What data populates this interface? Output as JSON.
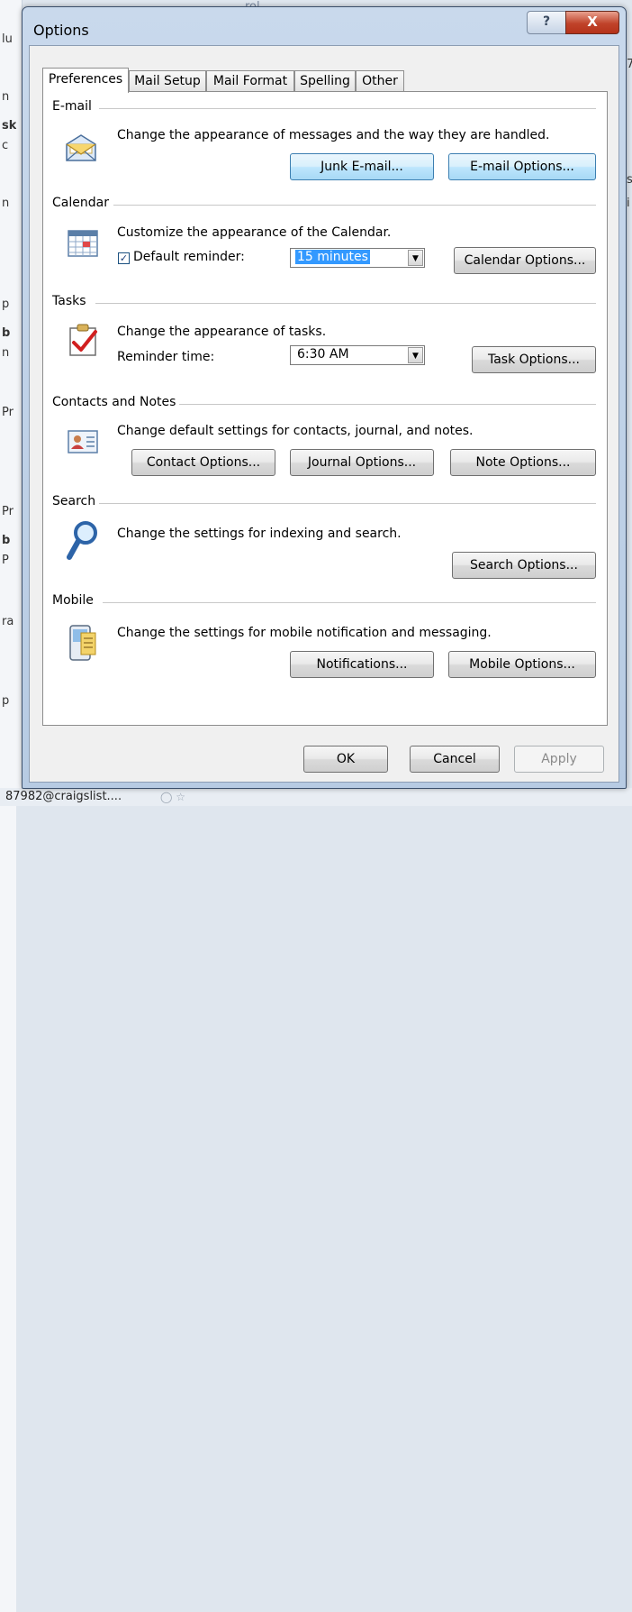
{
  "window": {
    "title": "Options",
    "help_label": "?",
    "close_label": "X"
  },
  "tabs": [
    {
      "label": "Preferences"
    },
    {
      "label": "Mail Setup"
    },
    {
      "label": "Mail Format"
    },
    {
      "label": "Spelling"
    },
    {
      "label": "Other"
    }
  ],
  "email": {
    "heading": "E-mail",
    "description": "Change the appearance of messages and the way they are handled.",
    "junk_button": "Junk E-mail...",
    "options_button": "E-mail Options..."
  },
  "calendar": {
    "heading": "Calendar",
    "description": "Customize the appearance of the Calendar.",
    "reminder_label": "Default reminder:",
    "reminder_checked": true,
    "reminder_value": "15 minutes",
    "options_button": "Calendar Options..."
  },
  "tasks": {
    "heading": "Tasks",
    "description": "Change the appearance of tasks.",
    "reminder_label": "Reminder time:",
    "reminder_value": "6:30 AM",
    "options_button": "Task Options..."
  },
  "contacts": {
    "heading": "Contacts and Notes",
    "description": "Change default settings for contacts, journal, and notes.",
    "contact_button": "Contact Options...",
    "journal_button": "Journal Options...",
    "note_button": "Note Options..."
  },
  "search": {
    "heading": "Search",
    "description": "Change the settings for indexing and search.",
    "options_button": "Search Options..."
  },
  "mobile": {
    "heading": "Mobile",
    "description": "Change the settings for mobile notification and messaging.",
    "notifications_button": "Notifications...",
    "options_button": "Mobile Options..."
  },
  "footer": {
    "ok": "OK",
    "cancel": "Cancel",
    "apply": "Apply"
  },
  "background": {
    "status_text": "87982@craigslist....",
    "fragments_left": [
      "lu",
      "n",
      "sk",
      "c",
      "n",
      "p",
      "b",
      "n",
      "Pr",
      "Pr",
      "b",
      "P",
      "ra",
      "p"
    ],
    "fragments_right": [
      "7",
      "s",
      "i"
    ],
    "top_text": "rol"
  }
}
